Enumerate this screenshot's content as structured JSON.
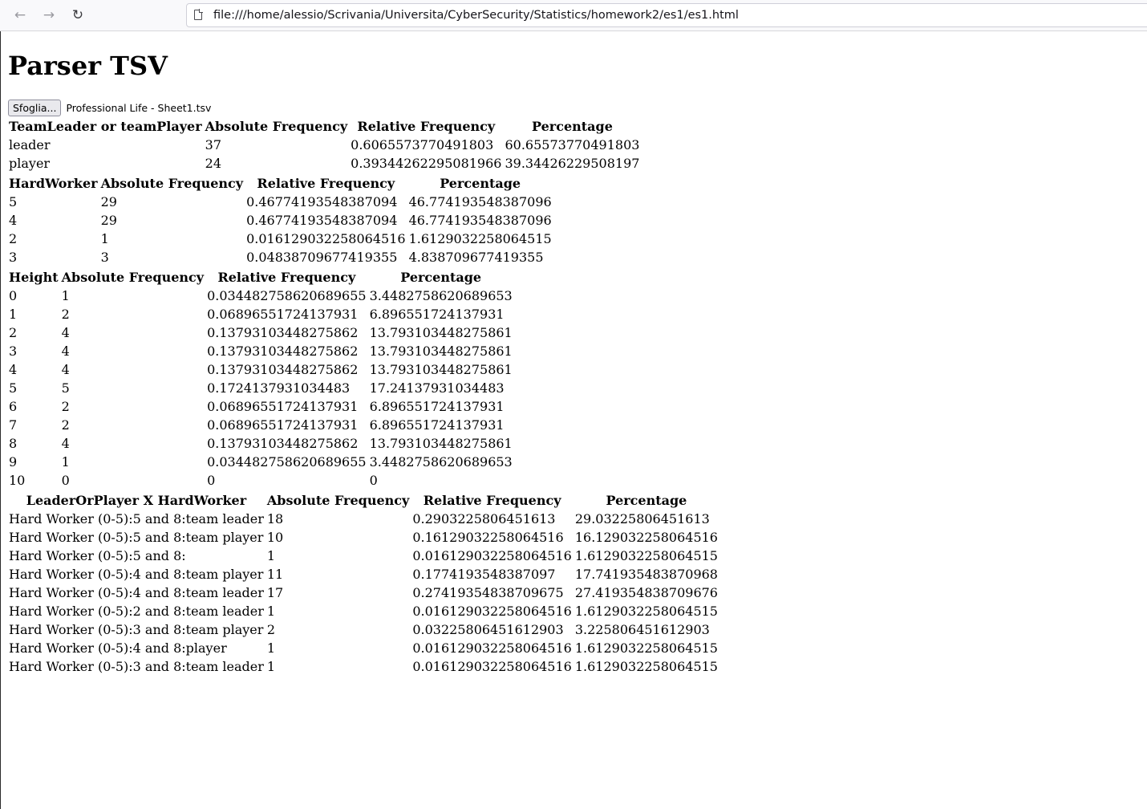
{
  "browser": {
    "url": "file:///home/alessio/Scrivania/Universita/CyberSecurity/Statistics/homework2/es1/es1.html",
    "icons": {
      "back": "arrow-left-icon",
      "forward": "arrow-right-icon",
      "reload": "reload-icon",
      "page": "page-icon"
    }
  },
  "page": {
    "title": "Parser TSV",
    "file_button": "Sfoglia...",
    "file_name": "Professional Life - Sheet1.tsv"
  },
  "tables": [
    {
      "headers": [
        "TeamLeader or teamPlayer",
        "Absolute Frequency",
        "Relative Frequency",
        "Percentage"
      ],
      "rows": [
        [
          "leader",
          "37",
          "0.6065573770491803",
          "60.65573770491803"
        ],
        [
          "player",
          "24",
          "0.3934426229508196​6",
          "39.34426229508197"
        ]
      ]
    },
    {
      "headers": [
        "HardWorker",
        "Absolute Frequency",
        "Relative Frequency",
        "Percentage"
      ],
      "rows": [
        [
          "5",
          "29",
          "0.46774193548387094",
          "46.774193548387096"
        ],
        [
          "4",
          "29",
          "0.46774193548387094",
          "46.774193548387096"
        ],
        [
          "2",
          "1",
          "0.016129032258064516",
          "1.6129032258064515"
        ],
        [
          "3",
          "3",
          "0.04838709677419355",
          "4.838709677419355"
        ]
      ]
    },
    {
      "headers": [
        "Height",
        "Absolute Frequency",
        "Relative Frequency",
        "Percentage"
      ],
      "rows": [
        [
          "0",
          "1",
          "0.034482758620689655",
          "3.4482758620689653"
        ],
        [
          "1",
          "2",
          "0.06896551724137931",
          "6.896551724137931"
        ],
        [
          "2",
          "4",
          "0.13793103448275862",
          "13.793103448275861"
        ],
        [
          "3",
          "4",
          "0.13793103448275862",
          "13.793103448275861"
        ],
        [
          "4",
          "4",
          "0.13793103448275862",
          "13.793103448275861"
        ],
        [
          "5",
          "5",
          "0.1724137931034483",
          "17.24137931034483"
        ],
        [
          "6",
          "2",
          "0.06896551724137931",
          "6.896551724137931"
        ],
        [
          "7",
          "2",
          "0.06896551724137931",
          "6.896551724137931"
        ],
        [
          "8",
          "4",
          "0.13793103448275862",
          "13.793103448275861"
        ],
        [
          "9",
          "1",
          "0.034482758620689655",
          "3.4482758620689653"
        ],
        [
          "10",
          "0",
          "0",
          "0"
        ]
      ]
    },
    {
      "headers": [
        "LeaderOrPlayer X HardWorker",
        "Absolute Frequency",
        "Relative Frequency",
        "Percentage"
      ],
      "rows": [
        [
          "Hard Worker (0-5):5 and 8:team leader",
          "18",
          "0.2903225806451613",
          "29.03225806451613"
        ],
        [
          "Hard Worker (0-5):5 and 8:team player",
          "10",
          "0.16129032258064516",
          "16.129032258064516"
        ],
        [
          "Hard Worker (0-5):5 and 8:",
          "1",
          "0.016129032258064516",
          "1.6129032258064515"
        ],
        [
          "Hard Worker (0-5):4 and 8:team player",
          "11",
          "0.1774193548387097",
          "17.741935483870968"
        ],
        [
          "Hard Worker (0-5):4 and 8:team leader",
          "17",
          "0.27419354838709675",
          "27.419354838709676"
        ],
        [
          "Hard Worker (0-5):2 and 8:team leader",
          "1",
          "0.016129032258064516",
          "1.6129032258064515"
        ],
        [
          "Hard Worker (0-5):3 and 8:team player",
          "2",
          "0.03225806451612903",
          "3.225806451612903"
        ],
        [
          "Hard Worker (0-5):4 and 8:player",
          "1",
          "0.016129032258064516",
          "1.6129032258064515"
        ],
        [
          "Hard Worker (0-5):3 and 8:team leader",
          "1",
          "0.016129032258064516",
          "1.6129032258064515"
        ]
      ]
    }
  ]
}
